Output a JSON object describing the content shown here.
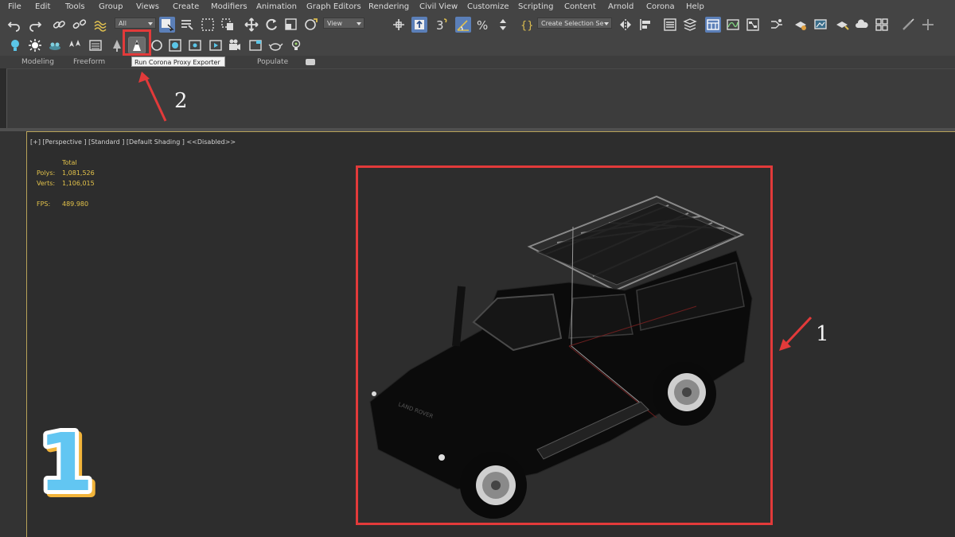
{
  "menubar": {
    "items": [
      "File",
      "Edit",
      "Tools",
      "Group",
      "Views",
      "Create",
      "Modifiers",
      "Animation",
      "Graph Editors",
      "Rendering",
      "Civil View",
      "Customize",
      "Scripting",
      "Content",
      "Arnold",
      "Corona",
      "Help"
    ]
  },
  "toolbar": {
    "selection_filter": "All",
    "reference_coord": "View",
    "named_selection": "Create Selection Se"
  },
  "ribbon": {
    "tabs": [
      "Modeling",
      "Freeform",
      "Populate"
    ]
  },
  "tooltip": "Run Corona Proxy Exporter",
  "viewport": {
    "label": "[+] [Perspective ] [Standard ] [Default Shading ]  <<Disabled>>",
    "stats": {
      "header": "Total",
      "polys_label": "Polys:",
      "polys_value": "1,081,526",
      "verts_label": "Verts:",
      "verts_value": "1,106,015",
      "fps_label": "FPS:",
      "fps_value": "489.980"
    }
  },
  "annotations": {
    "step1": "1",
    "step2": "2",
    "badge": "1"
  },
  "colors": {
    "highlight": "#e23a3a",
    "stats_text": "#e2c24a",
    "active_button": "#5b7fb8",
    "badge_fill": "#62c6f2"
  }
}
